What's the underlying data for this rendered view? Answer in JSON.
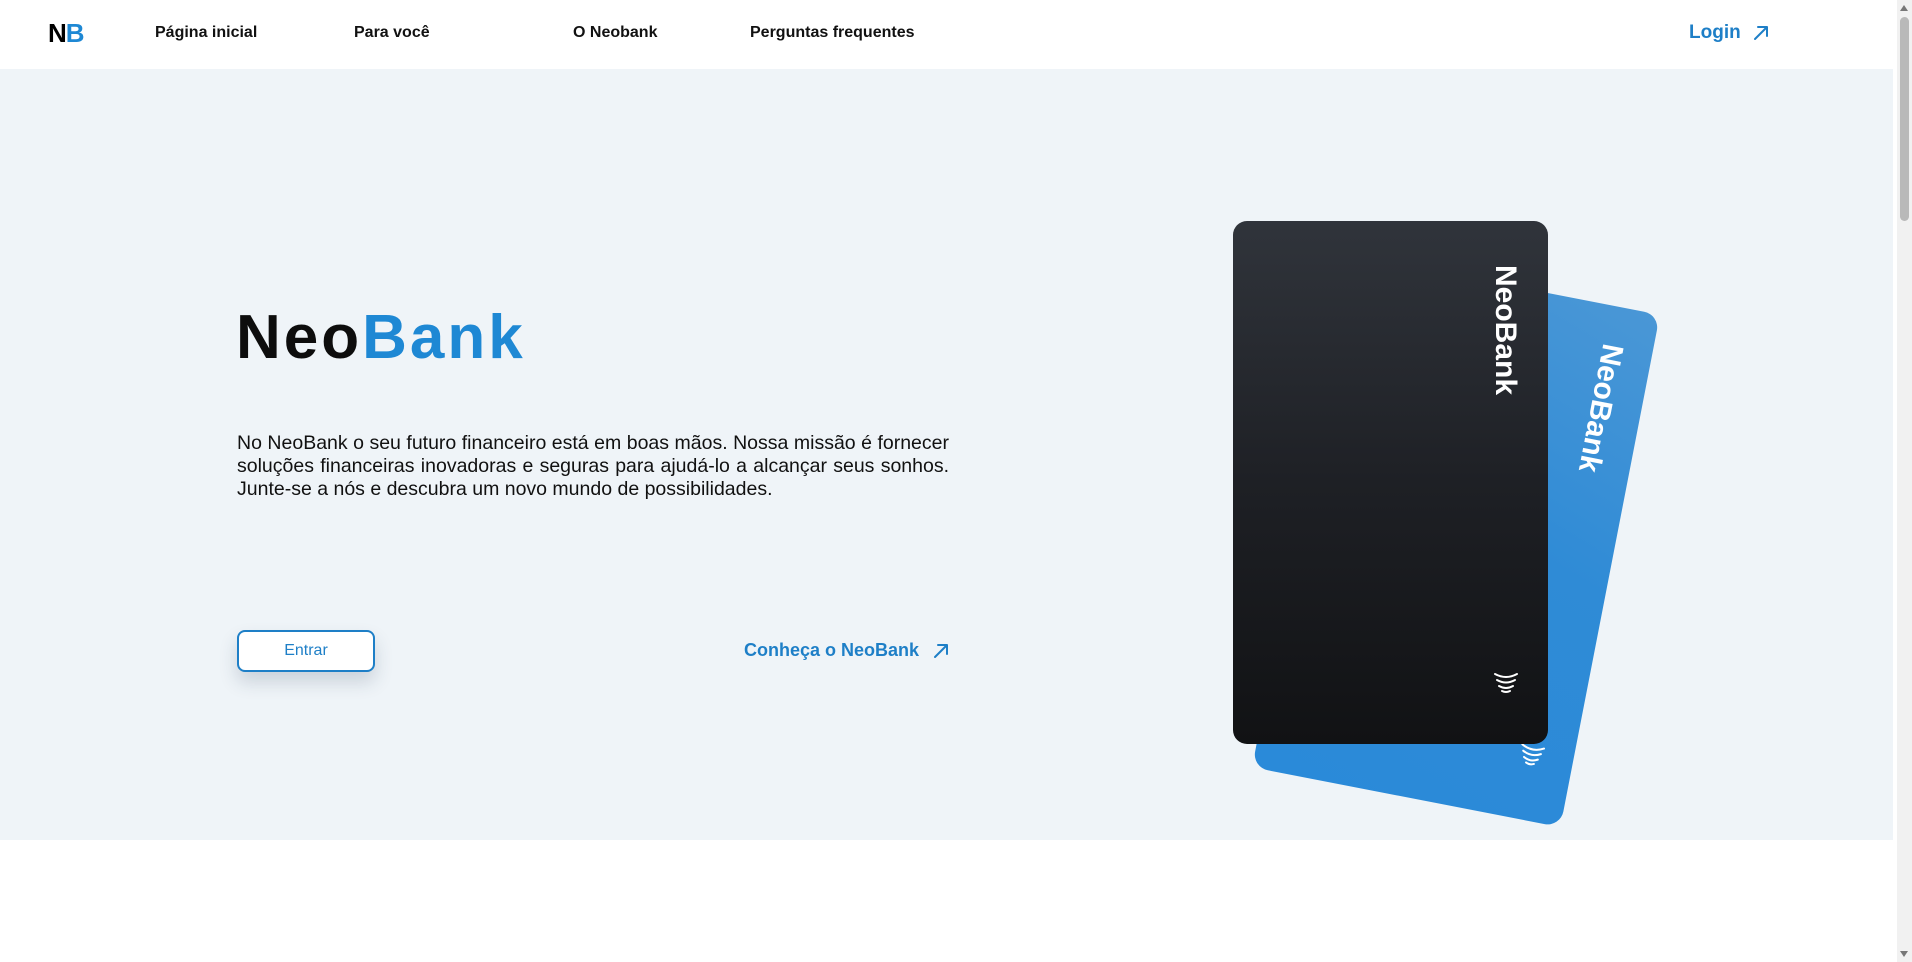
{
  "header": {
    "logo": {
      "n": "N",
      "b": "B"
    },
    "nav": [
      {
        "label": "Página inicial"
      },
      {
        "label": "Para você"
      },
      {
        "label": "O Neobank"
      },
      {
        "label": "Perguntas frequentes"
      }
    ],
    "login_label": "Login"
  },
  "hero": {
    "brand_neo": "Neo",
    "brand_bank": "Bank",
    "description": "No NeoBank o seu futuro financeiro está em boas mãos. Nossa missão é fornecer soluções financeiras inovadoras e seguras para ajudá-lo a alcançar seus sonhos. Junte-se a nós e descubra um novo mundo de possibilidades.",
    "entrar_label": "Entrar",
    "conheca_label": "Conheça o NeoBank"
  },
  "cards": {
    "black_label": "NeoBank",
    "blue_label": "NeoBank"
  },
  "colors": {
    "accent": "#1e88d4",
    "hero_bg": "#eff4f8",
    "card_black": "#1e2025",
    "card_blue": "#2a8ad9"
  },
  "icons": {
    "login": "arrow-up-right-icon",
    "conheca": "arrow-up-right-icon",
    "nfc": "contactless-icon"
  }
}
